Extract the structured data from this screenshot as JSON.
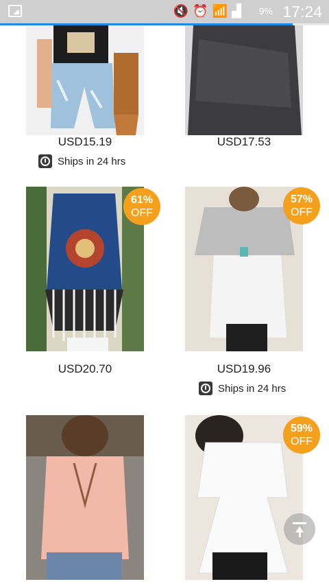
{
  "status_bar": {
    "time": "17:24",
    "battery": "9%",
    "icons": [
      "gallery-icon",
      "mute-icon",
      "alarm-icon",
      "wifi-icon",
      "signal-icon",
      "battery-charging-icon"
    ]
  },
  "page_load_progress": 0.89,
  "products": [
    {
      "price": "USD15.19",
      "ships": "Ships in 24 hrs",
      "discount": null,
      "image": "boho-top-denim-shorts"
    },
    {
      "price": "USD17.53",
      "ships": null,
      "discount": null,
      "image": "love-country-music-tank"
    },
    {
      "price": "USD20.70",
      "ships": null,
      "discount": {
        "pct": "61%",
        "label": "OFF"
      },
      "image": "tribal-print-fringe-halter"
    },
    {
      "price": "USD19.96",
      "ships": "Ships in 24 hrs",
      "discount": {
        "pct": "57%",
        "label": "OFF"
      },
      "image": "grey-white-cold-shoulder-top"
    },
    {
      "price": null,
      "ships": null,
      "discount": null,
      "image": "pink-v-neck-blouse"
    },
    {
      "price": null,
      "ships": null,
      "discount": {
        "pct": "59%",
        "label": "OFF"
      },
      "image": "white-peplum-top"
    }
  ],
  "colors": {
    "badge": "#f4a01c",
    "status_bar": "#cfcfcf",
    "progress": "#1e88e5",
    "text": "#222222"
  }
}
